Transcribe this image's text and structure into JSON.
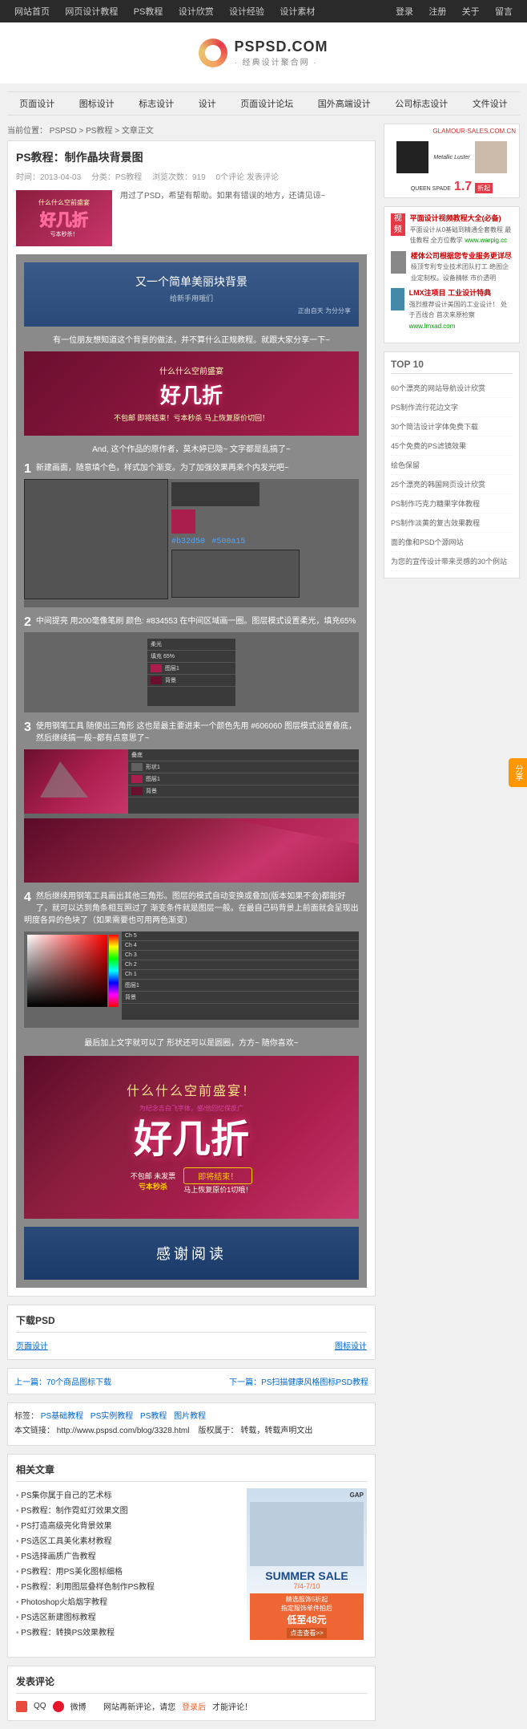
{
  "topbar": {
    "left": [
      "网站首页",
      "网页设计教程",
      "PS教程",
      "设计欣赏",
      "设计经验",
      "设计素材"
    ],
    "right": [
      "登录",
      "注册",
      "关于",
      "留言"
    ]
  },
  "logo": {
    "title": "PSPSD.COM",
    "sub": "· 经典设计聚合网 ·"
  },
  "nav": [
    "页面设计",
    "图标设计",
    "标志设计",
    "设计",
    "页面设计论坛",
    "国外高端设计",
    "公司标志设计",
    "文件设计"
  ],
  "breadcrumb": {
    "prefix": "当前位置：",
    "items": [
      "PSPSD",
      "PS教程",
      "文章正文"
    ]
  },
  "article": {
    "title": "PS教程：制作晶块背景图",
    "meta": {
      "date": "时间：2013-04-03",
      "cat": "分类：PS教程",
      "views": "浏览次数：919",
      "comments": "0个评论",
      "reply": "发表评论"
    },
    "intro": "用过了PSD，希望有帮助。如果有错误的地方，还请见谅~",
    "thumb": {
      "top": "什么什么空前盛宴",
      "main": "好几折",
      "bot": "亏本秒杀！"
    }
  },
  "tutorial": {
    "header": {
      "title": "又一个简单美丽块背景",
      "sub": "给新手用哦们",
      "right": "正由自天 为分分享"
    },
    "cap1": "有一位朋友想知道这个背景的做法，并不算什么正规教程。就跟大家分享一下~",
    "showcase": {
      "t1": "什么什么空前盛宴",
      "t2": "好几折",
      "t3": "不包邮 即将结束！亏本秒杀 马上恢复原价切回！"
    },
    "cap2": "And, 这个作品的原作者，莫木婷已隐~ 文字都是乱搞了~",
    "step1": {
      "num": "1",
      "text": "新建画面，随意填个色，样式加个渐变。为了加强效果再来个内发光吧~",
      "c1": "#b32d50",
      "c2": "#500a15"
    },
    "step2": {
      "num": "2",
      "text": "中间提亮 用200毫像笔刷 颜色: #834553 在中间区域画一圈。图层模式设置柔光，填充65%",
      "c": "#834553"
    },
    "step3": {
      "num": "3",
      "text": "使用钢笔工具 随便出三角形 这也是最主要进来一个颜色先用 #606060 图层模式设置叠底，然后继续搞一般~都有点意思了~",
      "c": "#606060"
    },
    "step4": {
      "num": "4",
      "text": "然后继续用钢笔工具画出其他三角形。图层的模式自动变换或叠加(版本如果不会)都能好了，就可以达到角条相互照过了 渐变条件就是图层一般。在最自己码背景上前面就会呈现出明度各异的色块了（如果需要也可用两色渐变）"
    },
    "cap3": "最后加上文字就可以了 形状还可以是圆圈，方方~ 随你喜欢~",
    "big": {
      "h1": "什么什么空前盛宴！",
      "sub": "为纪念吉白飞字体，感/他回忆保反广",
      "h2": "好几折",
      "l1": "不包邮 未发票",
      "badge": "即将结束！",
      "l2": "亏本秒杀",
      "l3": "马上恢复原价1切哦！"
    },
    "thanks": "感谢阅读"
  },
  "download": {
    "title": "下载PSD",
    "links": [
      "页面设计",
      "图标设计"
    ]
  },
  "pager": {
    "prev": "上一篇：70个商品图标下载",
    "next": "下一篇：PS扫描健康风格图标PSD教程"
  },
  "tagsrow": {
    "taglabel": "标签：",
    "tags": [
      "PS基础教程",
      "PS实例教程",
      "PS教程",
      "图片教程"
    ],
    "linklabel": "本文链接：",
    "link": "http://www.pspsd.com/blog/3328.html",
    "reflabel": "版权属于：",
    "ref": "转载，转载声明文出"
  },
  "related": {
    "title": "相关文章",
    "items": [
      "PS集你属于自己的艺术标",
      "PS教程：制作霓虹灯效果文图",
      "PS打造高级亮化背景效果",
      "PS选区工具美化素材教程",
      "PS选择画质广告教程",
      "PS教程：用PS美化图标细格",
      "PS教程：利用图层叠样色制作PS教程",
      "Photoshop火焰烟字教程",
      "PS选区新建图标教程",
      "PS教程：转换PS效果教程"
    ]
  },
  "ad2": {
    "brand": "GAP",
    "summer": "SUMMER SALE",
    "date": "7/4-7/10",
    "p1": "精选服饰5折起",
    "p2": "指定服饰单件拍后",
    "p3": "低至48元",
    "btn": "点击查看>>"
  },
  "comment": {
    "title": "发表评论",
    "qq": "QQ",
    "weibo": "微博",
    "hint": "网站再新评论，请您 ",
    "login": "登录后",
    "hint2": " 才能评论！"
  },
  "ad1": {
    "site": "GLAMOUR-SALES.COM.CN",
    "tag": "Metallic Luster",
    "brand": "QUEEN SPADE",
    "price": "1.7",
    "unit": "折起"
  },
  "promos": [
    {
      "title": "平面设计视频教程大全(必备)",
      "sub": "平面设计从0基础到精通全套教程 最佳教程 全方位教学",
      "url": "www.warpig.cc"
    },
    {
      "title": "楼体公司根据您专业服务更详尽",
      "sub": "极顶专利专业技术团队打工 绝图企业定制权。设备精帐 市价透明",
      "url": ""
    },
    {
      "title": "LMX注项目 工业设计特典",
      "sub": "强烈推荐设计美国的工业设计！",
      "url": "www.lmxad.com",
      "extra": "处于百线合 首次来原检察"
    }
  ],
  "top10": {
    "title": "TOP 10",
    "items": [
      "60个漂亮的网站导航设计欣赏",
      "PS制作流行花边文字",
      "30个简洁设计字体免费下载",
      "45个免费的PS滤镜效果",
      "绘色保留",
      "25个漂亮的韩国网页设计欣赏",
      "PS制作巧克力糖果字体教程",
      "PS制作淡黄的复古效果教程",
      "面的像和PSD个源网站",
      "为您的宣传设计带来灵感的30个例站"
    ]
  },
  "share": "分享"
}
